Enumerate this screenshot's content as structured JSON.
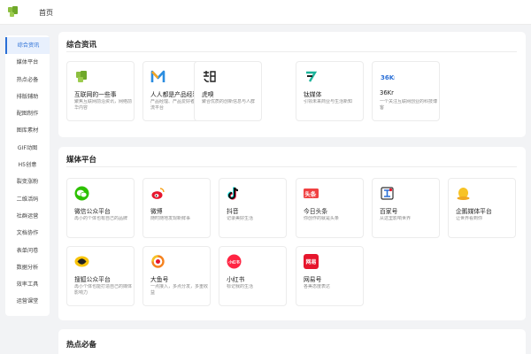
{
  "header": {
    "home_label": "首页"
  },
  "sidebar": {
    "items": [
      {
        "label": "综合资讯",
        "active": true
      },
      {
        "label": "媒体平台"
      },
      {
        "label": "热点必备"
      },
      {
        "label": "排版辅助"
      },
      {
        "label": "配图制作"
      },
      {
        "label": "图库素材"
      },
      {
        "label": "GIF动图"
      },
      {
        "label": "H5创意"
      },
      {
        "label": "裂变涨粉"
      },
      {
        "label": "二维活码"
      },
      {
        "label": "社群运营"
      },
      {
        "label": "文档协作"
      },
      {
        "label": "表单问卷"
      },
      {
        "label": "数据分析"
      },
      {
        "label": "效率工具"
      },
      {
        "label": "运营课堂"
      }
    ]
  },
  "sections": {
    "news": {
      "title": "综合资讯",
      "cards": [
        {
          "name": "互联网的一些事",
          "desc": "聚焦互联网前沿资讯，网络前华内容",
          "icon": "yixieshi-logo-icon"
        },
        {
          "name": "人人都是产品经理",
          "desc": "产品经理、产品爱好者学习交流平台",
          "icon": "woshipm-logo-icon"
        },
        {
          "name": "虎嗅",
          "desc": "聚合优质的创新信息与人群",
          "icon": "huxiu-logo-icon"
        },
        {
          "name": "钛媒体",
          "desc": "引领未来商业与生活新知",
          "icon": "tmtpost-logo-icon"
        },
        {
          "name": "36Kr",
          "desc": "一个关注互联网创业的科技博客",
          "icon": "36kr-logo-icon"
        }
      ]
    },
    "media": {
      "title": "媒体平台",
      "cards": [
        {
          "name": "微信公众平台",
          "desc": "再小的个体也有自己的品牌",
          "icon": "wechat-logo-icon"
        },
        {
          "name": "微博",
          "desc": "随时随地发现新鲜事",
          "icon": "weibo-logo-icon"
        },
        {
          "name": "抖音",
          "desc": "记录美好生活",
          "icon": "douyin-logo-icon"
        },
        {
          "name": "今日头条",
          "desc": "你创作的就是头条",
          "icon": "toutiao-logo-icon"
        },
        {
          "name": "百家号",
          "desc": "从这里影响世界",
          "icon": "baijiahao-logo-icon"
        },
        {
          "name": "企鹅媒体平台",
          "desc": "让世界看到你",
          "icon": "penguin-logo-icon"
        },
        {
          "name": "搜狐公众平台",
          "desc": "再小个体也能打造自己的媒体影响力",
          "icon": "sohu-logo-icon"
        },
        {
          "name": "大鱼号",
          "desc": "一点接入，多点分发，多重收益",
          "icon": "dayu-logo-icon"
        },
        {
          "name": "小红书",
          "desc": "标记我的生活",
          "icon": "xiaohongshu-logo-icon",
          "badge": "小红书"
        },
        {
          "name": "网易号",
          "desc": "各美态度表达",
          "icon": "wangyi-logo-icon",
          "badge": "网易"
        }
      ]
    },
    "hot": {
      "title": "热点必备"
    }
  },
  "colors": {
    "accent": "#2a6fd6",
    "wechat": "#2dc100",
    "weibo": "#e6162d",
    "toutiao": "#f04142",
    "xiaohongshu": "#ff2442",
    "penguin": "#f7c325"
  }
}
